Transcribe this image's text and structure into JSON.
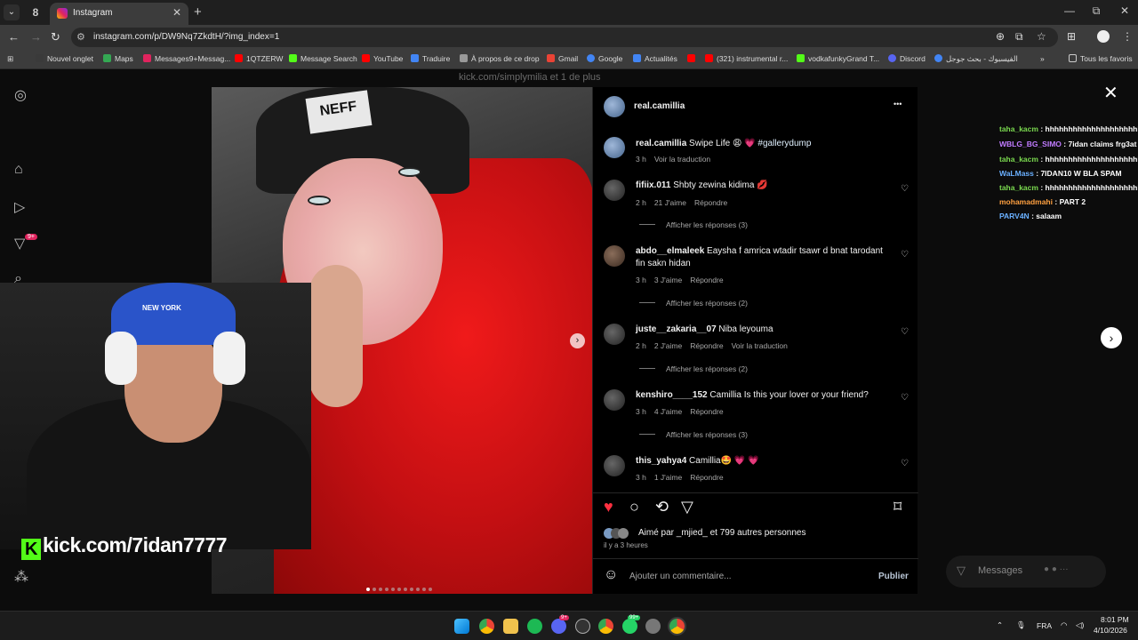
{
  "browser": {
    "tab_title": "Instagram",
    "tab_close": "✕",
    "new_tab": "+",
    "url": "instagram.com/p/DW9Nq7ZkdtH/?img_index=1",
    "window": {
      "minimize": "—",
      "maximize": "⧉",
      "close": "✕"
    }
  },
  "bookmarks": [
    {
      "label": "Nouvel onglet",
      "color": "#3a3a3a"
    },
    {
      "label": "Maps",
      "color": "#34a853"
    },
    {
      "label": "Messages9+Messag...",
      "color": "#e0245e"
    },
    {
      "label": "1QTZERW",
      "color": "#ff0000"
    },
    {
      "label": "Message Search",
      "color": "#53fc18"
    },
    {
      "label": "YouTube",
      "color": "#ff0000"
    },
    {
      "label": "Traduire",
      "color": "#4285f4"
    },
    {
      "label": "À propos de ce drop",
      "color": "#999999"
    },
    {
      "label": "Gmail",
      "color": "#ea4335"
    },
    {
      "label": "Google",
      "color": "#4285f4"
    },
    {
      "label": "Actualités",
      "color": "#4285f4"
    },
    {
      "label": "",
      "color": "#ff0000"
    },
    {
      "label": "(321) instrumental r...",
      "color": "#ff0000"
    },
    {
      "label": "vodkafunkyGrand T...",
      "color": "#53fc18"
    },
    {
      "label": "Discord",
      "color": "#5865f2"
    },
    {
      "label": "الفيسبوك - بحث جوجل",
      "color": "#4285f4"
    }
  ],
  "bookmarks_more": "»",
  "all_bookmarks": "Tous les favoris",
  "overlay_text": "kick.com/simplymilia et 1 de plus",
  "post": {
    "author": "real.camillia",
    "more": "•••",
    "caption_user": "real.camillia",
    "caption": "Swipe Life 😩 💗",
    "caption_tag": "#gallerydump",
    "caption_time": "3 h",
    "caption_translate": "Voir la traduction",
    "comments": [
      {
        "user": "fifiix.011",
        "text": "Shbty zewina kidima 💋",
        "time": "2 h",
        "likes": "21 J'aime",
        "reply": "Répondre",
        "translate": "",
        "replies": "Afficher les réponses (3)"
      },
      {
        "user": "abdo__elmaleek",
        "text": "Eaysha f amrica wtadir tsawr d bnat tarodant fin sakn hidan",
        "time": "3 h",
        "likes": "3 J'aime",
        "reply": "Répondre",
        "translate": "",
        "replies": "Afficher les réponses (2)"
      },
      {
        "user": "juste__zakaria__07",
        "text": "Niba leyouma",
        "time": "2 h",
        "likes": "2 J'aime",
        "reply": "Répondre",
        "translate": "Voir la traduction",
        "replies": "Afficher les réponses (2)"
      },
      {
        "user": "kenshiro____152",
        "text": "Camillia Is this your lover or your friend?",
        "time": "3 h",
        "likes": "4 J'aime",
        "reply": "Répondre",
        "translate": "",
        "replies": "Afficher les réponses (3)"
      },
      {
        "user": "this_yahya4",
        "text": "Camillia🤩 💗 💗",
        "time": "3 h",
        "likes": "1 J'aime",
        "reply": "Répondre",
        "translate": "",
        "replies": ""
      }
    ],
    "liked_by": "Aimé par _mjied_ et 799 autres personnes",
    "posted": "il y a 3 heures",
    "comment_placeholder": "Ajouter un commentaire...",
    "publish": "Publier"
  },
  "stream": {
    "kick_url": "kick.com/7idan7777",
    "cap_text": "NEW YORK",
    "hat_text": "NEFF"
  },
  "chat": [
    {
      "user": "taha_kacm",
      "msg": "hhhhhhhhhhhhhhhhhhhhh",
      "color": "#7ad94f"
    },
    {
      "user": "WBLG_BG_SIMO",
      "msg": "7idan claims frg3at l",
      "color": "#c07bff"
    },
    {
      "user": "taha_kacm",
      "msg": "hhhhhhhhhhhhhhhhhhhhh",
      "color": "#7ad94f"
    },
    {
      "user": "WaLMass",
      "msg": "7IDAN10 W BLA SPAM",
      "color": "#6ab0ff"
    },
    {
      "user": "taha_kacm",
      "msg": "hhhhhhhhhhhhhhhhhhhhh",
      "color": "#7ad94f"
    },
    {
      "user": "mohamadmahi",
      "msg": "PART 2",
      "color": "#ffa040"
    },
    {
      "user": "PARV4N",
      "msg": "salaam",
      "color": "#6ab0ff"
    }
  ],
  "messages_label": "Messages",
  "notif_badge": "9+",
  "taskbar": {
    "lang": "FRA",
    "time": "8:01 PM",
    "date": "4/10/2026",
    "badge_discord": "9+",
    "badge_whatsapp": "99+"
  }
}
